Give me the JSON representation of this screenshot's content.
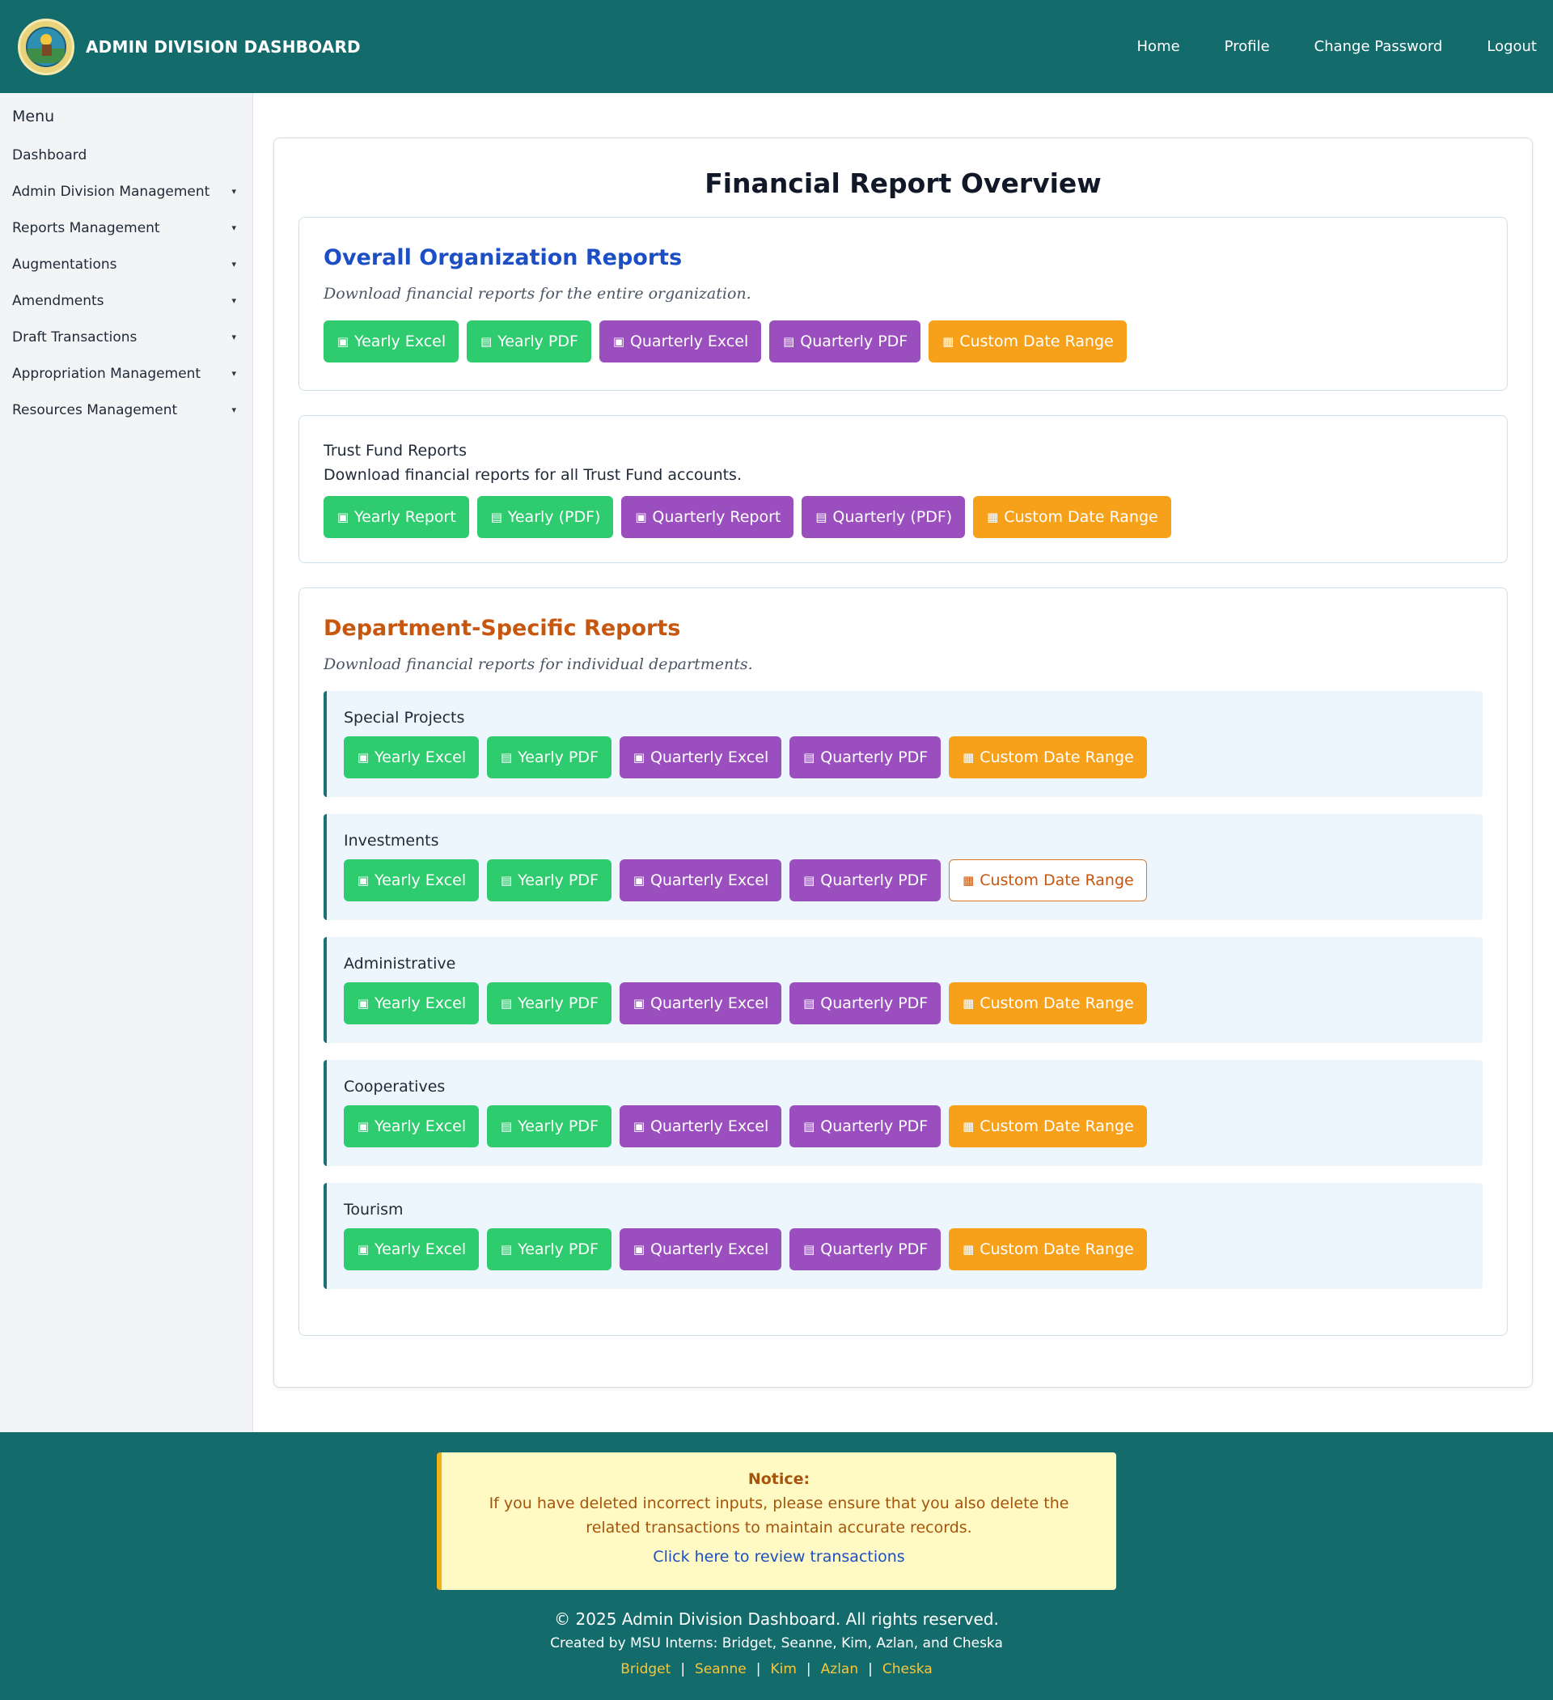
{
  "header": {
    "brand": "ADMIN DIVISION DASHBOARD",
    "nav": [
      "Home",
      "Profile",
      "Change Password",
      "Logout"
    ]
  },
  "sidebar": {
    "title": "Menu",
    "items": [
      {
        "label": "Dashboard",
        "caret": ""
      },
      {
        "label": "Admin Division Management",
        "caret": "▾"
      },
      {
        "label": "Reports Management",
        "caret": "▾"
      },
      {
        "label": "Augmentations",
        "caret": "▾"
      },
      {
        "label": "Amendments",
        "caret": "▾"
      },
      {
        "label": "Draft Transactions",
        "caret": "▾"
      },
      {
        "label": "Appropriation Management",
        "caret": "▾"
      },
      {
        "label": "Resources Management",
        "caret": "▾"
      }
    ]
  },
  "main": {
    "title": "Financial Report Overview",
    "overall": {
      "heading": "Overall Organization Reports",
      "desc": "Download financial reports for the entire organization.",
      "buttons": [
        "Yearly Excel",
        "Yearly PDF",
        "Quarterly Excel",
        "Quarterly PDF",
        "Custom Date Range"
      ]
    },
    "trust": {
      "heading": "Trust Fund Reports",
      "desc": "Download financial reports for all Trust Fund accounts.",
      "buttons": [
        "Yearly Report",
        "Yearly (PDF)",
        "Quarterly Report",
        "Quarterly (PDF)",
        "Custom Date Range"
      ]
    },
    "dept": {
      "heading": "Department-Specific Reports",
      "desc": "Download financial reports for individual departments.",
      "buttons": [
        "Yearly Excel",
        "Yearly PDF",
        "Quarterly Excel",
        "Quarterly PDF",
        "Custom Date Range"
      ],
      "departments": [
        "Special Projects",
        "Investments",
        "Administrative",
        "Cooperatives",
        "Tourism"
      ]
    }
  },
  "icons": {
    "excel": "▣",
    "pdf": "▤",
    "calendar": "▦"
  },
  "footer": {
    "notice_title": "Notice:",
    "notice_text": "If you have deleted incorrect inputs, please ensure that you also delete the related transactions to maintain accurate records.",
    "notice_link": "Click here to review transactions",
    "copyright": "© 2025 Admin Division Dashboard. All rights reserved.",
    "credits": "Created by MSU Interns: Bridget, Seanne, Kim, Azlan, and Cheska",
    "names": [
      "Bridget",
      "Seanne",
      "Kim",
      "Azlan",
      "Cheska"
    ],
    "separator": "|"
  },
  "colors": {
    "header_bg": "#136b6b",
    "green": "#2fcb6f",
    "purple": "#9b4fbf",
    "orange": "#f7a11a",
    "link_yellow": "#f7c63a"
  }
}
